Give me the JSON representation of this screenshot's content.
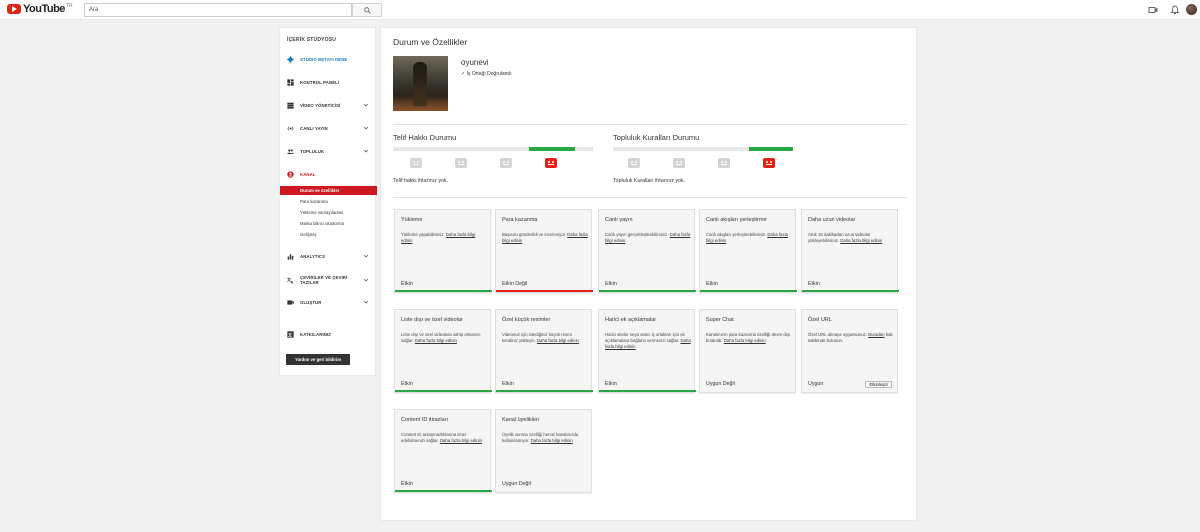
{
  "colors": {
    "accent_red": "#cc181e",
    "status_green": "#27a844",
    "status_red": "#e62117",
    "link_blue": "#167ac6"
  },
  "header": {
    "logo_text": "YouTube",
    "region": "TR",
    "search_placeholder": "Ara"
  },
  "sidebar": {
    "title": "İÇERİK STÜDYOSU",
    "items": [
      {
        "label": "STUDIO BETAYI DENE",
        "icon": "gear-icon"
      },
      {
        "label": "KONTROL PANELİ",
        "icon": "dashboard-icon"
      },
      {
        "label": "VİDEO YÖNETİCİSİ",
        "icon": "video-manager-icon"
      },
      {
        "label": "CANLI YAYIN",
        "icon": "live-icon"
      },
      {
        "label": "TOPLULUK",
        "icon": "community-icon"
      },
      {
        "label": "KANAL",
        "icon": "channel-icon"
      },
      {
        "label": "ANALYTICS",
        "icon": "analytics-icon"
      },
      {
        "label": "ÇEVİRİLER VE ÇEVİRİ TAZILAR",
        "icon": "translate-icon"
      },
      {
        "label": "OLUŞTUR",
        "icon": "create-icon"
      },
      {
        "label": "KATKILARINIZ",
        "icon": "contributions-icon"
      }
    ],
    "channel_sub": [
      "Durum ve özellikler",
      "Para kazanma",
      "Yükleme varsayılanları",
      "Marka bilinci oluşturma",
      "Gelişmiş"
    ],
    "help_button": "Yardım ve geri bildirim"
  },
  "main": {
    "title": "Durum ve Özellikler",
    "channel_name": "oyunevi",
    "verified": "✓ İş Ortağı Doğrulandı",
    "copyright": {
      "title": "Telif Hakkı Durumu",
      "text": "Telif hakkı ihtarınız yok."
    },
    "community": {
      "title": "Topluluk Kuralları Durumu",
      "text": "Topluluk Kuralları ihtarınız yok."
    },
    "cards": [
      {
        "title": "Yükleme",
        "desc": "Yükleme yapabilirsiniz. ",
        "link": "Daha fazla bilgi edinin",
        "status": "Etkin",
        "bar": "green"
      },
      {
        "title": "Para kazanma",
        "desc": "Başvuru gönderildi ve inceleniyor. ",
        "link": "Daha fazla bilgi edinin",
        "status": "Etkin Değil",
        "bar": "red"
      },
      {
        "title": "Canlı yayın",
        "desc": "Canlı yayın gerçekleştirebilirsiniz. ",
        "link": "Daha fazla bilgi edinin",
        "status": "Etkin",
        "bar": "green"
      },
      {
        "title": "Canlı akışları yerleştirme",
        "desc": "Canlı akışları yerleştirebilirsiniz. ",
        "link": "Daha fazla bilgi edinin",
        "status": "Etkin",
        "bar": "green"
      },
      {
        "title": "Daha uzun videolar",
        "desc": "Artık 15 dakikadan uzun videolar yükleyebilirsiniz. ",
        "link": "Daha fazla bilgi edinin",
        "status": "Etkin",
        "bar": "green"
      },
      {
        "title": "Liste dışı ve özel videolar",
        "desc": "Liste dışı ve özel videolara sahip olmanızı sağlar. ",
        "link": "Daha fazla bilgi edinin",
        "status": "Etkin",
        "bar": "green"
      },
      {
        "title": "Özel küçük resimler",
        "desc": "Videonuz için istediğiniz küçük resmi kendiniz yükleyin. ",
        "link": "Daha fazla bilgi edinin",
        "status": "Etkin",
        "bar": "green"
      },
      {
        "title": "Harici ek açıklamalar",
        "desc": "Harici siteler veya satıcı iş ortakları için ek açıklamalara bağlantı vermenizi sağlar. ",
        "link": "Daha fazla bilgi edinin",
        "status": "Etkin",
        "bar": "green"
      },
      {
        "title": "Super Chat",
        "desc": "Kanalınızın para kazanma özelliği devre dışı bırakıldı. ",
        "link": "Daha fazla bilgi edinin",
        "status": "Uygun Değil",
        "bar": "none"
      },
      {
        "title": "Özel URL",
        "desc_pre": "Özel URL almaya uygunsunuz. ",
        "desc_link": "Buradan",
        "desc_post": " hak talebinde bulunun.",
        "status": "Uygun",
        "bar": "none",
        "button": "Etkinleştir"
      },
      {
        "title": "Content ID itirazları",
        "desc": "Content ID anlaşmazlıklarına itiraz edebilmenizi sağlar. ",
        "link": "Daha fazla bilgi edinin",
        "status": "Etkin",
        "bar": "green"
      },
      {
        "title": "Kanal üyelikleri",
        "desc": "Üyelik sunma özelliği henüz kanalınızda kullanılamıyor. ",
        "link": "Daha fazla bilgi edinin",
        "status": "Uygun Değil",
        "bar": "none"
      }
    ]
  }
}
